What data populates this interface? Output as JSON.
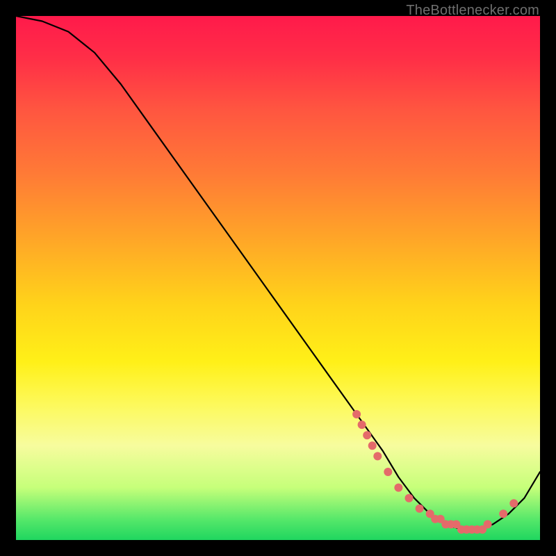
{
  "attribution": "TheBottlenecker.com",
  "chart_data": {
    "type": "line",
    "title": "",
    "xlabel": "",
    "ylabel": "",
    "xlim": [
      0,
      100
    ],
    "ylim": [
      0,
      100
    ],
    "series": [
      {
        "name": "curve",
        "x": [
          0,
          5,
          10,
          15,
          20,
          25,
          30,
          35,
          40,
          45,
          50,
          55,
          60,
          65,
          70,
          73,
          76,
          79,
          82,
          85,
          88,
          91,
          94,
          97,
          100
        ],
        "y": [
          100,
          99,
          97,
          93,
          87,
          80,
          73,
          66,
          59,
          52,
          45,
          38,
          31,
          24,
          17,
          12,
          8,
          5,
          3,
          2,
          2,
          3,
          5,
          8,
          13
        ]
      }
    ],
    "markers": {
      "name": "highlight-dots",
      "color": "#e46a6a",
      "x": [
        65,
        66,
        67,
        68,
        69,
        71,
        73,
        75,
        77,
        79,
        80,
        81,
        82,
        83,
        84,
        85,
        86,
        87,
        88,
        89,
        90,
        93,
        95
      ],
      "y": [
        24,
        22,
        20,
        18,
        16,
        13,
        10,
        8,
        6,
        5,
        4,
        4,
        3,
        3,
        3,
        2,
        2,
        2,
        2,
        2,
        3,
        5,
        7
      ]
    }
  }
}
